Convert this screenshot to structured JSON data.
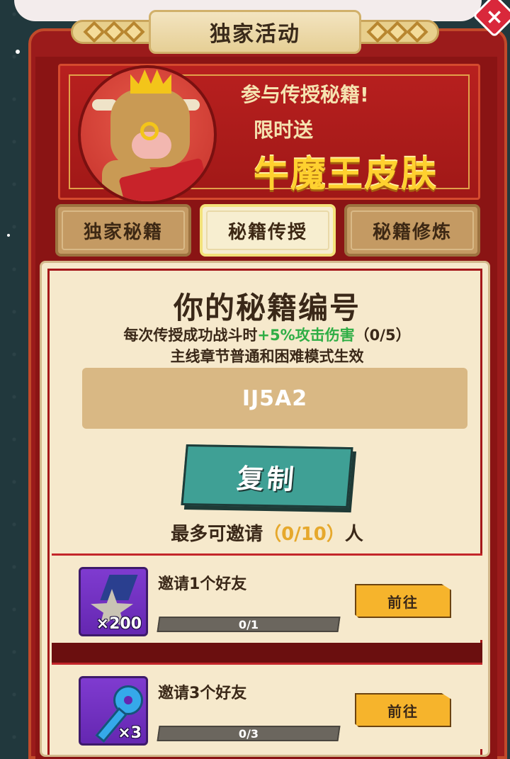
{
  "header": {
    "title": "独家活动",
    "close_label": "×"
  },
  "promo": {
    "line1": "参与传授秘籍!",
    "line2": "限时送",
    "line3": "牛魔王皮肤"
  },
  "tabs": [
    {
      "label": "独家秘籍",
      "active": false
    },
    {
      "label": "秘籍传授",
      "active": true
    },
    {
      "label": "秘籍修炼",
      "active": false
    }
  ],
  "card": {
    "title": "你的秘籍编号",
    "desc_prefix": "每次传授成功战斗时",
    "desc_bonus": "+5%攻击伤害",
    "desc_suffix": "（0/5）",
    "desc_line2": "主线章节普通和困难模式生效",
    "code": "IJ5A2",
    "copy_label": "复制",
    "invite_prefix": "最多可邀请",
    "invite_count": "（0/10）",
    "invite_suffix": "人"
  },
  "rewards": [
    {
      "label": "邀请1个好友",
      "icon": "medal-icon",
      "count": "×200",
      "progress": "0/1",
      "button": "前往"
    },
    {
      "label": "邀请3个好友",
      "icon": "key-icon",
      "count": "×3",
      "progress": "0/3",
      "button": "前往"
    }
  ],
  "colors": {
    "panel_red": "#9b1b1b",
    "card_bg": "#f6e9cc",
    "accent_gold": "#ffd12f",
    "bonus_green": "#2fae45",
    "copy_teal": "#3fa095",
    "go_orange": "#f6b42c"
  }
}
